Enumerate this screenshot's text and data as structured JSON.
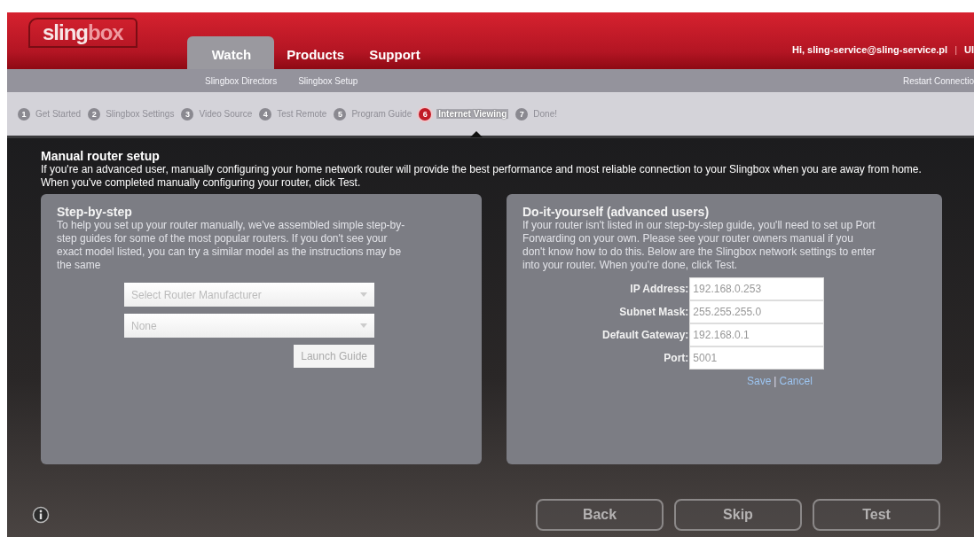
{
  "header": {
    "logo": {
      "main": "sling",
      "faded": "box"
    },
    "tabs": [
      {
        "label": "Watch",
        "selected": true
      },
      {
        "label": "Products",
        "selected": false
      },
      {
        "label": "Support",
        "selected": false
      }
    ],
    "greeting": "Hi, sling-service@sling-service.pl",
    "separator": "|",
    "cut_link": "Ul"
  },
  "subnav": {
    "links": [
      "Slingbox Directors",
      "Slingbox Setup"
    ],
    "right_link": "Restart Connectio"
  },
  "steps": [
    {
      "number": "1",
      "label": "Get Started",
      "selected": false
    },
    {
      "number": "2",
      "label": "Slingbox Settings",
      "selected": false
    },
    {
      "number": "3",
      "label": "Video Source",
      "selected": false
    },
    {
      "number": "4",
      "label": "Test Remote",
      "selected": false
    },
    {
      "number": "5",
      "label": "Program Guide",
      "selected": false
    },
    {
      "number": "6",
      "label": "Internet Viewing",
      "selected": true
    },
    {
      "number": "7",
      "label": "Done!",
      "selected": false
    }
  ],
  "page": {
    "title": "Manual router setup",
    "intro": "If you're an advanced user, manually configuring your home network router will provide the best performance and most reliable connection to your Slingbox when you are away from home. When you've completed manually configuring your router, click Test."
  },
  "step_by_step": {
    "title": "Step-by-step",
    "text": "To help you set up your router manually, we've assembled simple step-by-step guides for some of the most popular routers. If you don't see your exact model listed, you can try a similar model as the instructions may be the same",
    "dropdowns": [
      {
        "value": "Select Router Manufacturer"
      },
      {
        "value": "None"
      }
    ],
    "button": "Launch Guide"
  },
  "diy": {
    "title": "Do-it-yourself (advanced users)",
    "text": "If your router isn't listed in our step-by-step guide, you'll need to set up Port Forwarding on your own. Please see your router owners manual if you don't know how to do this. Below are the Slingbox network settings to enter into your router. When you're done, click Test.",
    "fields": [
      {
        "label": "IP Address:",
        "value": "192.168.0.253"
      },
      {
        "label": "Subnet Mask:",
        "value": "255.255.255.0"
      },
      {
        "label": "Default Gateway:",
        "value": "192.168.0.1"
      },
      {
        "label": "Port:",
        "value": "5001"
      }
    ],
    "save": "Save",
    "divider": "|",
    "cancel": "Cancel"
  },
  "footer": {
    "buttons": [
      {
        "label": "Back",
        "disabled": true
      },
      {
        "label": "Skip",
        "disabled": true
      },
      {
        "label": "Test",
        "disabled": true
      }
    ]
  }
}
